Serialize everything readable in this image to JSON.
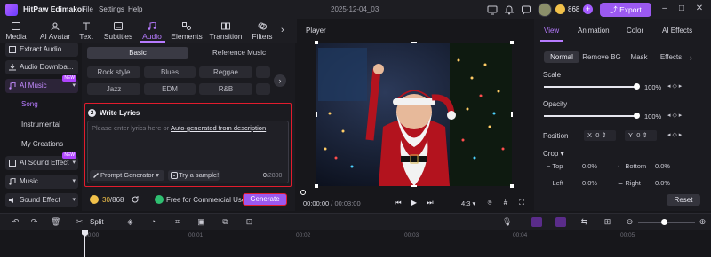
{
  "titlebar": {
    "app_title": "HitPaw Edimakor",
    "menu": [
      "File",
      "Settings",
      "Help"
    ],
    "date": "2025-12-04_03",
    "coins": "868",
    "export_label": "Export"
  },
  "tabs": [
    {
      "label": "Media",
      "icon": "media-icon"
    },
    {
      "label": "AI Avatar",
      "icon": "ai-avatar-icon"
    },
    {
      "label": "Text",
      "icon": "text-icon"
    },
    {
      "label": "Subtitles",
      "icon": "subtitles-icon"
    },
    {
      "label": "Audio",
      "icon": "audio-icon",
      "active": true
    },
    {
      "label": "Elements",
      "icon": "elements-icon"
    },
    {
      "label": "Transition",
      "icon": "transition-icon"
    },
    {
      "label": "Filters",
      "icon": "filters-icon"
    }
  ],
  "sidebar": {
    "items": [
      {
        "label": "Extract Audio"
      },
      {
        "label": "Audio Downloa..."
      },
      {
        "label": "AI Music"
      },
      {
        "label": "AI Sound Effect"
      },
      {
        "label": "Music"
      },
      {
        "label": "Sound Effect"
      }
    ],
    "subitems": [
      "Song",
      "Instrumental",
      "My Creations"
    ],
    "new_badge": "NEW"
  },
  "music": {
    "mode_tabs": [
      "Basic",
      "Reference Music"
    ],
    "genres": [
      "Rock style",
      "Blues",
      "Reggae",
      "Jazz",
      "EDM",
      "R&B"
    ],
    "lyrics": {
      "step": "2",
      "title": "Write Lyrics",
      "placeholder": "Please enter lyrics here or",
      "auto_link": "Auto-generated from description",
      "prompt_generator": "Prompt Generator",
      "try_sample": "Try a sample!",
      "count_current": "0",
      "count_max": "/2800"
    },
    "credits_current": "30",
    "credits_total": "/868",
    "free_label": "Free for Commercial Use",
    "generate_label": "Generate"
  },
  "player": {
    "title": "Player",
    "time_current": "00:00:00",
    "time_total": " / 00:03:00",
    "aspect": "4:3"
  },
  "inspector": {
    "tabs": [
      "View",
      "Animation",
      "Color",
      "AI Effects"
    ],
    "subtabs": [
      "Normal",
      "Remove BG",
      "Mask",
      "Effects"
    ],
    "scale_label": "Scale",
    "scale_value": "100%",
    "scale_level": 1.0,
    "opacity_label": "Opacity",
    "opacity_value": "100%",
    "opacity_level": 1.0,
    "position_label": "Position",
    "pos_x_label": "X",
    "pos_x": "0",
    "pos_y_label": "Y",
    "pos_y": "0",
    "crop_label": "Crop",
    "crop": [
      {
        "label": "Top",
        "value": "0.0%"
      },
      {
        "label": "Bottom",
        "value": "0.0%"
      },
      {
        "label": "Left",
        "value": "0.0%"
      },
      {
        "label": "Right",
        "value": "0.0%"
      }
    ],
    "reset_label": "Reset"
  },
  "timeline": {
    "split_label": "Split",
    "ticks": [
      "00:00",
      "00:01",
      "00:02",
      "00:03",
      "00:04",
      "00:05"
    ]
  },
  "colors": {
    "accent": "#9b59f0",
    "highlight_border": "#e21c2d",
    "coin": "#f1c14a"
  }
}
